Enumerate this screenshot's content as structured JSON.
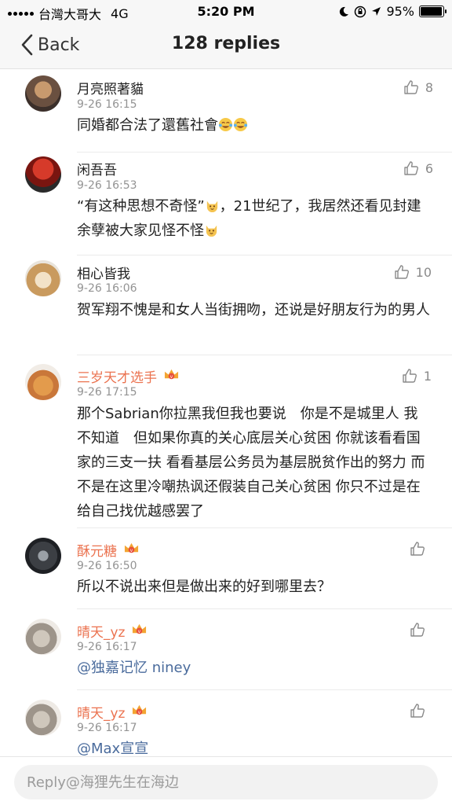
{
  "status_bar": {
    "carrier": "台灣大哥大",
    "network": "4G",
    "time": "5:20 PM",
    "battery": "95%",
    "battery_level": 0.95
  },
  "nav": {
    "back_label": "Back",
    "title": "128 replies"
  },
  "replies": [
    {
      "username": "月亮照著貓",
      "time": "9-26 16:15",
      "text": "同婚都合法了還舊社會",
      "likes": "8",
      "vip": false
    },
    {
      "username": "闲吾吾",
      "time": "9-26 16:53",
      "text_1": "“有这种思想不奇怪”",
      "text_2": "，21世纪了，我居然还看见封建余孽被大家见怪不怪",
      "likes": "6",
      "vip": false
    },
    {
      "username": "相心皆我",
      "time": "9-26 16:06",
      "text": "贺军翔不愧是和女人当街拥吻，还说是好朋友行为的男人",
      "likes": "10",
      "vip": false
    },
    {
      "username": "三岁天才选手",
      "time": "9-26 17:15",
      "text": "那个Sabrian你拉黑我但我也要说　你是不是城里人 我不知道　但如果你真的关心底层关心贫困 你就该看看国家的三支一扶 看看基层公务员为基层脱贫作出的努力 而不是在这里冷嘲热讽还假装自己关心贫困 你只不过是在给自己找优越感罢了",
      "likes": "1",
      "vip": true
    },
    {
      "username": "酥元糖",
      "time": "9-26 16:50",
      "text": "所以不说出来但是做出来的好到哪里去？",
      "likes": "",
      "vip": true
    },
    {
      "username": "晴天_yz",
      "time": "9-26 16:17",
      "text": "@独嘉记忆 niney",
      "likes": "",
      "vip": true
    },
    {
      "username": "晴天_yz",
      "time": "9-26 16:17",
      "text": "@Max宣宣",
      "likes": "",
      "vip": true
    }
  ],
  "reply_input": {
    "placeholder": "Reply@海狸先生在海边"
  },
  "colors": {
    "vip_name": "#eb7350",
    "mention": "#4a6b9c",
    "meta": "#939393",
    "bar_bg": "#f7f7f7"
  }
}
